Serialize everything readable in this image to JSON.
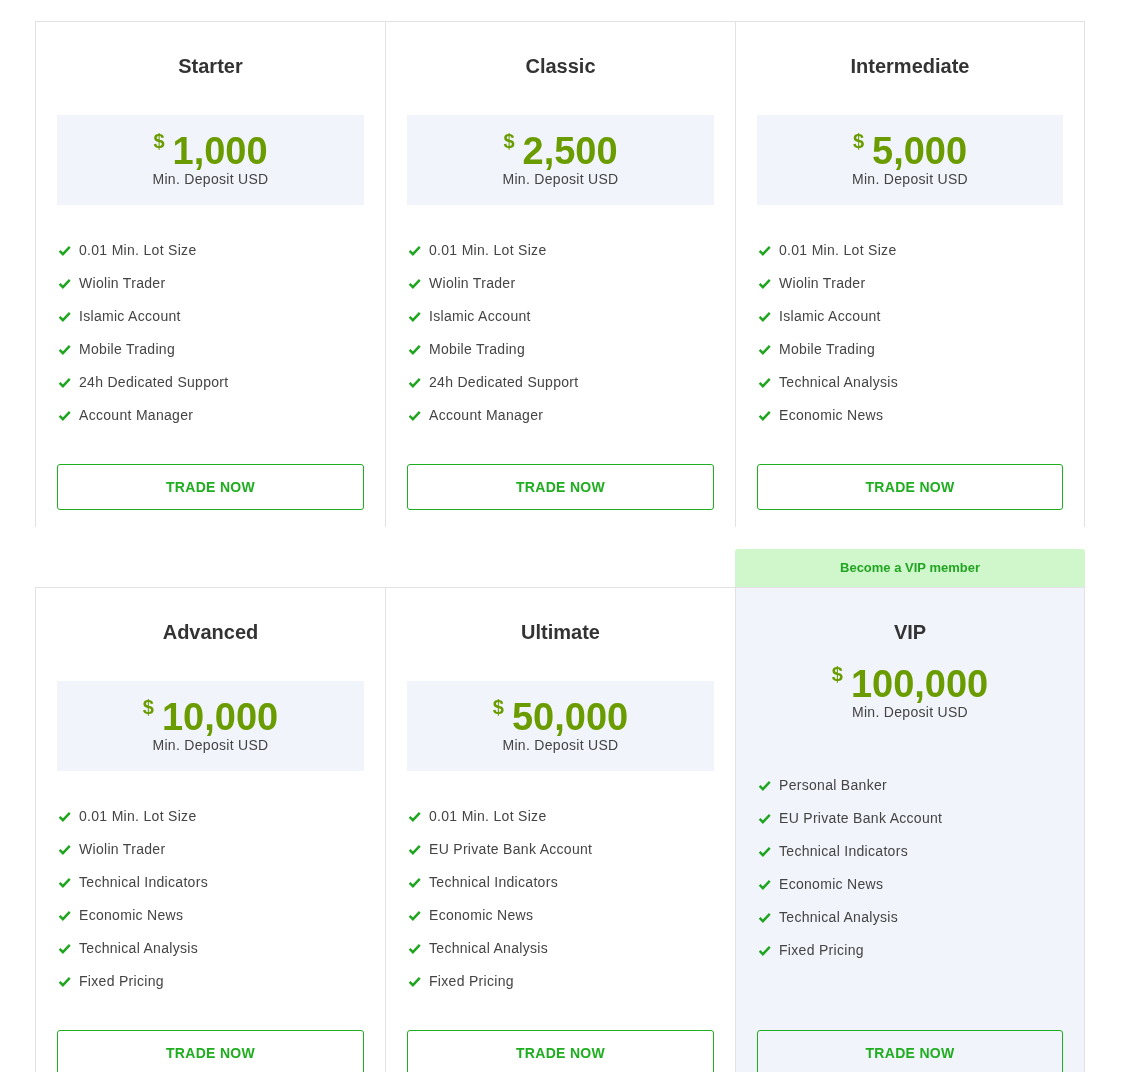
{
  "rows": [
    {
      "plans": [
        {
          "kind": "standard",
          "name": "Starter",
          "currency": "$",
          "amount": "1,000",
          "deposit_label": "Min. Deposit USD",
          "features": [
            "0.01 Min. Lot Size",
            "Wiolin Trader",
            "Islamic Account",
            "Mobile Trading",
            "24h Dedicated Support",
            "Account Manager"
          ],
          "button": "TRADE NOW"
        },
        {
          "kind": "standard",
          "name": "Classic",
          "currency": "$",
          "amount": "2,500",
          "deposit_label": "Min. Deposit USD",
          "features": [
            "0.01 Min. Lot Size",
            "Wiolin Trader",
            "Islamic Account",
            "Mobile Trading",
            "24h Dedicated Support",
            "Account Manager"
          ],
          "button": "TRADE NOW"
        },
        {
          "kind": "standard",
          "name": "Intermediate",
          "currency": "$",
          "amount": "5,000",
          "deposit_label": "Min. Deposit USD",
          "features": [
            "0.01 Min. Lot Size",
            "Wiolin Trader",
            "Islamic Account",
            "Mobile Trading",
            "Technical Analysis",
            "Economic News"
          ],
          "button": "TRADE NOW"
        }
      ]
    },
    {
      "plans": [
        {
          "kind": "standard",
          "name": "Advanced",
          "currency": "$",
          "amount": "10,000",
          "deposit_label": "Min. Deposit USD",
          "features": [
            "0.01 Min. Lot Size",
            "Wiolin Trader",
            "Technical Indicators",
            "Economic News",
            "Technical Analysis",
            "Fixed Pricing"
          ],
          "button": "TRADE NOW"
        },
        {
          "kind": "standard",
          "name": "Ultimate",
          "currency": "$",
          "amount": "50,000",
          "deposit_label": "Min. Deposit USD",
          "features": [
            "0.01 Min. Lot Size",
            "EU Private Bank Account",
            "Technical Indicators",
            "Economic News",
            "Technical Analysis",
            "Fixed Pricing"
          ],
          "button": "TRADE NOW"
        },
        {
          "kind": "featured",
          "badge": "Become a VIP member",
          "name": "VIP",
          "currency": "$",
          "amount": "100,000",
          "deposit_label": "Min. Deposit USD",
          "features": [
            "Personal Banker",
            "EU Private Bank Account",
            "Technical Indicators",
            "Economic News",
            "Technical Analysis",
            "Fixed Pricing"
          ],
          "button": "TRADE NOW"
        }
      ]
    }
  ]
}
